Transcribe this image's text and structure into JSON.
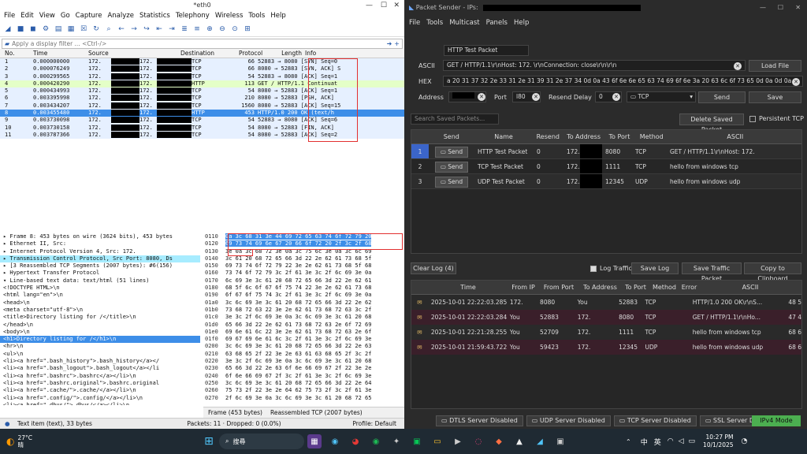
{
  "wireshark": {
    "title": "*eth0",
    "menu": [
      "File",
      "Edit",
      "View",
      "Go",
      "Capture",
      "Analyze",
      "Statistics",
      "Telephony",
      "Wireless",
      "Tools",
      "Help"
    ],
    "filter_placeholder": "Apply a display filter ... <Ctrl-/>",
    "columns": [
      "No.",
      "Time",
      "Source",
      "Destination",
      "Protocol",
      "Length",
      "Info"
    ],
    "packets": [
      {
        "no": "1",
        "time": "0.000000000",
        "src": "172.",
        "dst": "172.",
        "proto": "TCP",
        "len": "66",
        "info": "52883 → 8080 [SYN] Seq=0",
        "kind": "tcp"
      },
      {
        "no": "2",
        "time": "0.000076249",
        "src": "172.",
        "dst": "172.",
        "proto": "TCP",
        "len": "66",
        "info": "8080 → 52883 [SYN, ACK] S",
        "kind": "tcp"
      },
      {
        "no": "3",
        "time": "0.000299565",
        "src": "172.",
        "dst": "172.",
        "proto": "TCP",
        "len": "54",
        "info": "52883 → 8080 [ACK] Seq=1",
        "kind": "tcp"
      },
      {
        "no": "4",
        "time": "0.000420290",
        "src": "172.",
        "dst": "172.",
        "proto": "HTTP",
        "len": "113",
        "info": "GET / HTTP/1.1 Continuat",
        "kind": "http"
      },
      {
        "no": "5",
        "time": "0.000434993",
        "src": "172.",
        "dst": "172.",
        "proto": "TCP",
        "len": "54",
        "info": "8080 → 52883 [ACK] Seq=1",
        "kind": "tcp"
      },
      {
        "no": "6",
        "time": "0.003395998",
        "src": "172.",
        "dst": "172.",
        "proto": "TCP",
        "len": "210",
        "info": "8080 → 52883 [PSH, ACK]",
        "kind": "tcp"
      },
      {
        "no": "7",
        "time": "0.003434207",
        "src": "172.",
        "dst": "172.",
        "proto": "TCP",
        "len": "1560",
        "info": "8080 → 52883 [ACK] Seq=15",
        "kind": "tcp"
      },
      {
        "no": "8",
        "time": "0.003455480",
        "src": "172.",
        "dst": "172.",
        "proto": "HTTP",
        "len": "453",
        "info": "HTTP/1.0 200 OK (text/h",
        "kind": "sel"
      },
      {
        "no": "9",
        "time": "0.003730098",
        "src": "172.",
        "dst": "172.",
        "proto": "TCP",
        "len": "54",
        "info": "52883 → 8080 [ACK] Seq=6",
        "kind": "tcp"
      },
      {
        "no": "10",
        "time": "0.003730158",
        "src": "172.",
        "dst": "172.",
        "proto": "TCP",
        "len": "54",
        "info": "8080 → 52883 [FIN, ACK]",
        "kind": "tcp"
      },
      {
        "no": "11",
        "time": "0.003787366",
        "src": "172.",
        "dst": "172.",
        "proto": "TCP",
        "len": "54",
        "info": "8080 → 52883 [ACK] Seq=2",
        "kind": "tcp"
      }
    ],
    "tree": [
      {
        "t": "▸ Frame 8: 453 bytes on wire (3624 bits), 453 bytes",
        "k": ""
      },
      {
        "t": "▸ Ethernet II, Src:",
        "k": ""
      },
      {
        "t": "▸ Internet Protocol Version 4, Src: 172.",
        "k": ""
      },
      {
        "t": "▸ Transmission Control Protocol, Src Port: 8080, Ds",
        "k": "hl"
      },
      {
        "t": "▸ [3 Reassembled TCP Segments (2007 bytes): #6(156)",
        "k": ""
      },
      {
        "t": "▸ Hypertext Transfer Protocol",
        "k": ""
      },
      {
        "t": "▾ Line-based text data: text/html (51 lines)",
        "k": ""
      },
      {
        "t": "      <!DOCTYPE HTML>\\n",
        "k": ""
      },
      {
        "t": "      <html lang=\"en\">\\n",
        "k": ""
      },
      {
        "t": "      <head>\\n",
        "k": ""
      },
      {
        "t": "      <meta charset=\"utf-8\">\\n",
        "k": ""
      },
      {
        "t": "      <title>Directory listing for /</title>\\n",
        "k": ""
      },
      {
        "t": "      </head>\\n",
        "k": ""
      },
      {
        "t": "      <body>\\n",
        "k": ""
      },
      {
        "t": "      <h1>Directory listing for /</h1>\\n",
        "k": "sel"
      },
      {
        "t": "      <hr>\\n",
        "k": ""
      },
      {
        "t": "      <ul>\\n",
        "k": ""
      },
      {
        "t": "      <li><a href=\".bash_history\">.bash_history</a></",
        "k": ""
      },
      {
        "t": "      <li><a href=\".bash_logout\">.bash_logout</a></li",
        "k": ""
      },
      {
        "t": "      <li><a href=\".bashrc\">.bashrc</a></li>\\n",
        "k": ""
      },
      {
        "t": "      <li><a href=\".bashrc.original\">.bashrc.original",
        "k": ""
      },
      {
        "t": "      <li><a href=\".cache/\">.cache/</a></li>\\n",
        "k": ""
      },
      {
        "t": "      <li><a href=\".config/\">.config/</a></li>\\n",
        "k": ""
      },
      {
        "t": "      <li><a href=\".dbus/\">.dbus/</a></li>\\n",
        "k": ""
      },
      {
        "t": "      <li><a href=\".face\">.face</a></li>\\n",
        "k": ""
      }
    ],
    "hex": [
      {
        "off": "0110",
        "bytes": "0a 3c 68 31 3e 44 69 72  65 63 74 6f 72 79 20"
      },
      {
        "off": "0120",
        "bytes": "69 73 74 69 6e 67 20 66  6f 72 20 2f 3c 2f 68"
      },
      {
        "off": "0130",
        "bytes": "3e 0a 3c 68 72 3e 0a 3c  75 6c 3e 0a 3c 6c 69"
      },
      {
        "off": "0140",
        "bytes": "3c 61 20 68 72 65 66 3d  22 2e 62 61 73 68 5f"
      },
      {
        "off": "0150",
        "bytes": "69 73 74 6f 72 79 22 3e  2e 62 61 73 68 5f 68"
      },
      {
        "off": "0160",
        "bytes": "73 74 6f 72 79 3c 2f 61  3e 3c 2f 6c 69 3e 0a"
      },
      {
        "off": "0170",
        "bytes": "6c 69 3e 3c 61 20 68 72  65 66 3d 22 2e 62 61"
      },
      {
        "off": "0180",
        "bytes": "68 5f 6c 6f 67 6f 75 74  22 3e 2e 62 61 73 68"
      },
      {
        "off": "0190",
        "bytes": "6f 67 6f 75 74 3c 2f 61  3e 3c 2f 6c 69 3e 0a"
      },
      {
        "off": "01a0",
        "bytes": "3c 6c 69 3e 3c 61 20 68  72 65 66 3d 22 2e 62"
      },
      {
        "off": "01b0",
        "bytes": "73 68 72 63 22 3e 2e 62  61 73 68 72 63 3c 2f"
      },
      {
        "off": "01c0",
        "bytes": "3e 3c 2f 6c 69 3e 0a 3c  6c 69 3e 3c 61 20 68"
      },
      {
        "off": "01d0",
        "bytes": "65 66 3d 22 2e 62 61 73  68 72 63 2e 6f 72 69"
      },
      {
        "off": "01e0",
        "bytes": "69 6e 61 6c 22 3e 2e 62  61 73 68 72 63 2e 6f"
      },
      {
        "off": "01f0",
        "bytes": "69 67 69 6e 61 6c 3c 2f  61 3e 3c 2f 6c 69 3e"
      },
      {
        "off": "0200",
        "bytes": "3c 6c 69 3e 3c 61 20 68  72 65 66 3d 22 2e 63"
      },
      {
        "off": "0210",
        "bytes": "63 68 65 2f 22 3e 2e 63  61 63 68 65 2f 3c 2f"
      },
      {
        "off": "0220",
        "bytes": "3e 3c 2f 6c 69 3e 0a 3c  6c 69 3e 3c 61 20 68"
      },
      {
        "off": "0230",
        "bytes": "65 66 3d 22 2e 63 6f 6e  66 69 67 2f 22 3e 2e"
      },
      {
        "off": "0240",
        "bytes": "6f 6e 66 69 67 2f 3c 2f  61 3e 3c 2f 6c 69 3e"
      },
      {
        "off": "0250",
        "bytes": "3c 6c 69 3e 3c 61 20 68  72 65 66 3d 22 2e 64"
      },
      {
        "off": "0260",
        "bytes": "75 73 2f 22 3e 2e 64 62  75 73 2f 3c 2f 61 3e"
      },
      {
        "off": "0270",
        "bytes": "2f 6c 69 3e 0a 3c 6c 69  3e 3c 61 20 68 72 65"
      }
    ],
    "bytes_tabs": [
      "Frame (453 bytes)",
      "Reassembled TCP (2007 bytes)"
    ],
    "status": {
      "item": "Text item (text), 33 bytes",
      "packets": "Packets: 11 · Dropped: 0 (0.0%)",
      "profile": "Profile: Default"
    }
  },
  "ps": {
    "title": "Packet Sender - IPs:",
    "menu": [
      "File",
      "Tools",
      "Multicast",
      "Panels",
      "Help"
    ],
    "name_value": "HTTP Test Packet",
    "ascii_label": "ASCII",
    "ascii_value": "GET / HTTP/1.1\\r\\nHost: 172.                   \\r\\nConnection: close\\r\\n\\r\\n",
    "hex_label": "HEX",
    "hex_value": "a 20 31 37 32 2e 33 31 2e 31 39 31 2e 37 34 0d 0a 43 6f 6e 6e 65 63 74 69 6f 6e 3a 20 63 6c 6f 73 65 0d 0a 0d 0a",
    "load_file": "Load File",
    "address_label": "Address",
    "port_label": "Port",
    "port_value": "l80",
    "resend_label": "Resend Delay",
    "resend_value": "0",
    "proto_value": "TCP",
    "send": "Send",
    "save": "Save",
    "search_placeholder": "Search Saved Packets...",
    "delete_saved": "Delete Saved Packet",
    "persistent": "Persistent TCP",
    "saved_cols": [
      "Send",
      "Name",
      "Resend",
      "To Address",
      "To Port",
      "Method",
      "ASCII"
    ],
    "saved": [
      {
        "n": "1",
        "send": "Send",
        "name": "HTTP Test Packet",
        "resend": "0",
        "addr": "172.",
        "port": "8080",
        "method": "TCP",
        "ascii": "GET / HTTP/1.1\\r\\nHost: 172."
      },
      {
        "n": "2",
        "send": "Send",
        "name": "TCP Test Packet",
        "resend": "0",
        "addr": "172.",
        "port": "1111",
        "method": "TCP",
        "ascii": "hello from windows tcp"
      },
      {
        "n": "3",
        "send": "Send",
        "name": "UDP Test Packet",
        "resend": "0",
        "addr": "172.",
        "port": "12345",
        "method": "UDP",
        "ascii": "hello from windows udp"
      }
    ],
    "clear_log": "Clear Log (4)",
    "log_traffic": "Log Traffic",
    "save_log": "Save Log",
    "save_traffic": "Save Traffic Packet",
    "copy_clip": "Copy to Clipboard",
    "log_cols": [
      "Time",
      "From IP",
      "From Port",
      "To Address",
      "To Port",
      "Method",
      "Error",
      "ASCII"
    ],
    "log": [
      {
        "time": "2025-10-01 22:22:03.285",
        "from": "172.",
        "fport": "8080",
        "to": "You",
        "tport": "52883",
        "method": "TCP",
        "err": "",
        "ascii": "HTTP/1.0 200 OK\\r\\nS...",
        "hex": "48 5",
        "kind": "in"
      },
      {
        "time": "2025-10-01 22:22:03.284",
        "from": "You",
        "fport": "52883",
        "to": "172.",
        "tport": "8080",
        "method": "TCP",
        "err": "",
        "ascii": "GET / HTTP/1.1\\r\\nHo...",
        "hex": "47 4",
        "kind": "out"
      },
      {
        "time": "2025-10-01 22:21:28.255",
        "from": "You",
        "fport": "52709",
        "to": "172.",
        "tport": "1111",
        "method": "TCP",
        "err": "",
        "ascii": "hello from windows tcp",
        "hex": "68 6",
        "kind": "in"
      },
      {
        "time": "2025-10-01 21:59:43.722",
        "from": "You",
        "fport": "59423",
        "to": "172.",
        "tport": "12345",
        "method": "UDP",
        "err": "",
        "ascii": "hello from windows udp",
        "hex": "68 6",
        "kind": "out"
      }
    ],
    "footer": [
      "DTLS Server Disabled",
      "UDP Server Disabled",
      "TCP Server Disabled",
      "SSL Server Disabled"
    ],
    "ipv4": "IPv4 Mode",
    "accent": "#3b65c9",
    "ipv4_color": "#4caf50"
  },
  "taskbar": {
    "temp": "27°C",
    "weather": "晴",
    "search": "搜尋",
    "ime_cn": "中",
    "ime_en": "英",
    "time": "10:27 PM",
    "date": "10/1/2025"
  }
}
